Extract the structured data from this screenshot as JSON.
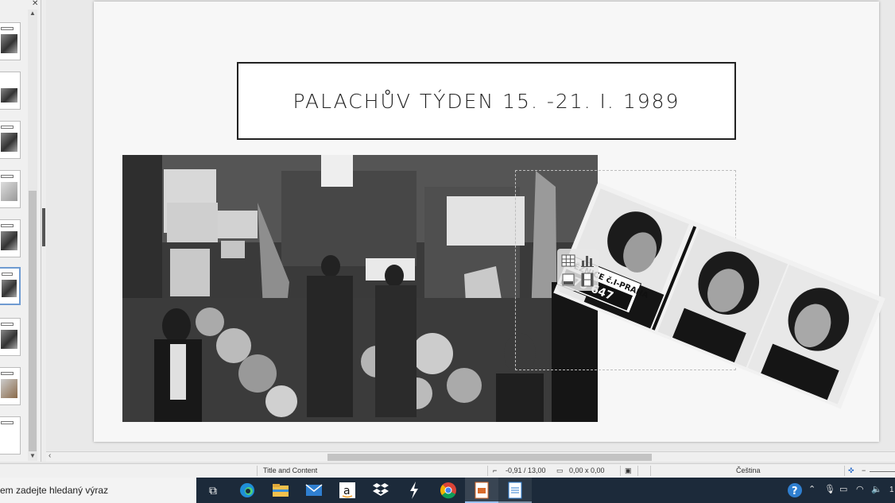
{
  "slide": {
    "title": "PALACHŮV TÝDEN 15. -21. I. 1989"
  },
  "photos": {
    "mugshot_placard_line1": "VĚZNICE č.I-PRAHA",
    "mugshot_placard_line2": "979 647"
  },
  "status_bar": {
    "layout_name": "Title and Content",
    "position": "-0,91 / 13,00",
    "size": "0,00 x 0,00",
    "language": "Čeština"
  },
  "taskbar": {
    "search_placeholder": "em zadejte hledaný výraz",
    "clock_fragment": "1",
    "apps": [
      "task-view",
      "edge",
      "file-explorer",
      "mail",
      "amazon",
      "dropbox",
      "bolt",
      "chrome",
      "impress",
      "writer"
    ]
  },
  "colors": {
    "taskbar": "#1c2a3a",
    "selection": "#6f9bd1"
  }
}
